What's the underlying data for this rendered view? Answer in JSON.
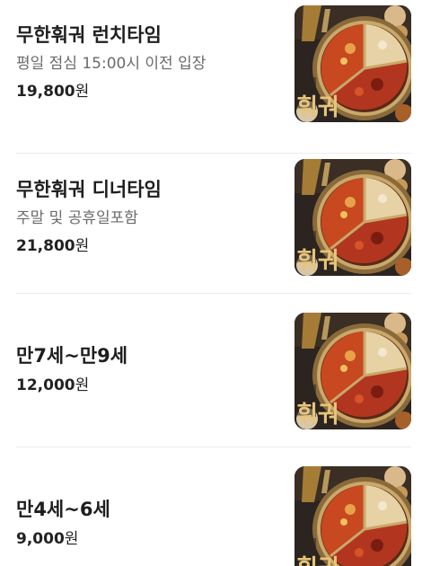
{
  "menu": {
    "items": [
      {
        "name": "무한훠궈 런치타임",
        "description": "평일 점심 15:00시 이전 입장",
        "price": "19,800",
        "currency_unit": "원",
        "image_text": "훠궈"
      },
      {
        "name": "무한훠궈 디너타임",
        "description": "주말 및 공휴일포함",
        "price": "21,800",
        "currency_unit": "원",
        "image_text": "훠궈"
      },
      {
        "name": "만7세~만9세",
        "description": "",
        "price": "12,000",
        "currency_unit": "원",
        "image_text": "훠궈"
      },
      {
        "name": "만4세~6세",
        "description": "",
        "price": "9,000",
        "currency_unit": "원",
        "image_text": "훠궈"
      }
    ]
  }
}
